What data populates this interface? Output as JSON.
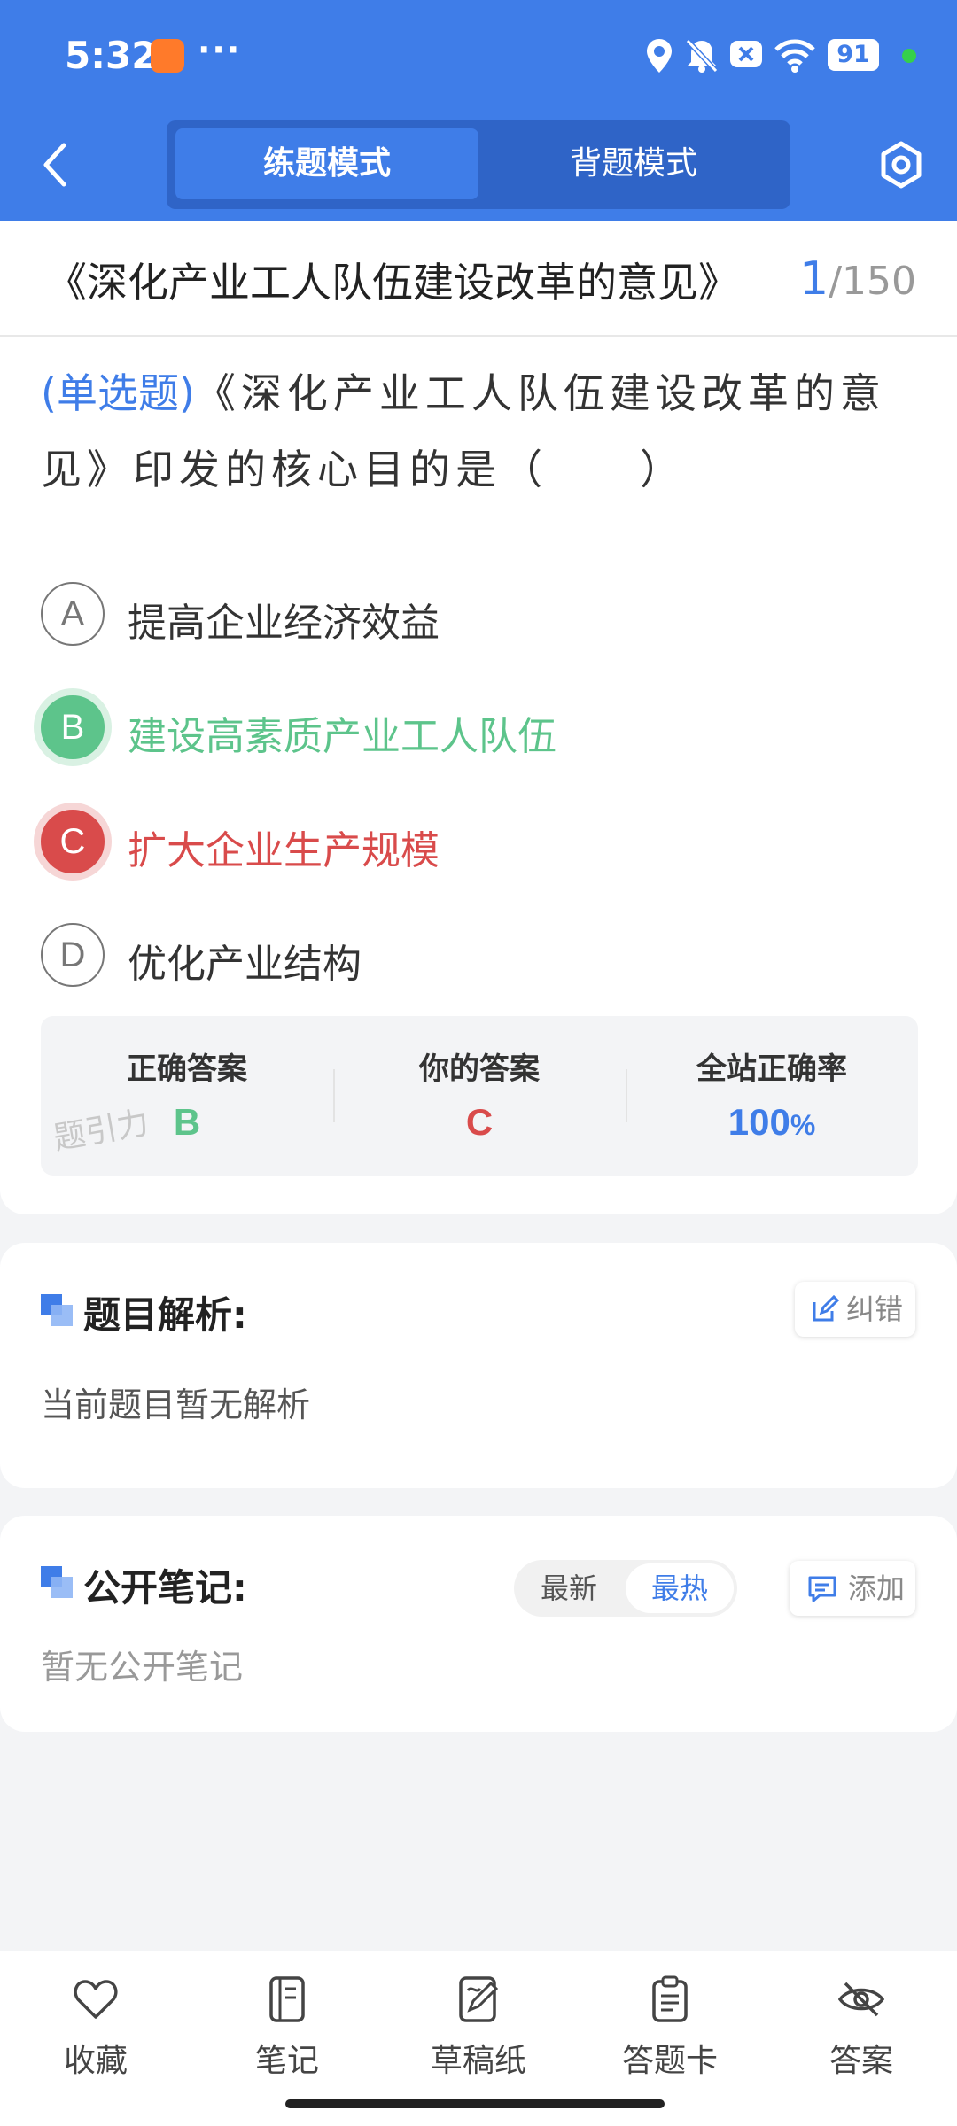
{
  "status_bar": {
    "time": "5:32",
    "more": "···",
    "battery": "91"
  },
  "header": {
    "back_icon": "chevron-left-icon",
    "mode_active": "练题模式",
    "mode_inactive": "背题模式",
    "settings_icon": "settings-hexagon-icon"
  },
  "doc": {
    "title": "《深化产业工人队伍建设改革的意见》",
    "current": "1",
    "total": "/150"
  },
  "question": {
    "type": "(单选题)",
    "text": "《深化产业工人队伍建设改革的意见》印发的核心目的是（　　）",
    "options": [
      {
        "letter": "A",
        "text": "提高企业经济效益",
        "state": "normal"
      },
      {
        "letter": "B",
        "text": "建设高素质产业工人队伍",
        "state": "correct"
      },
      {
        "letter": "C",
        "text": "扩大企业生产规模",
        "state": "wrong"
      },
      {
        "letter": "D",
        "text": "优化产业结构",
        "state": "normal"
      }
    ]
  },
  "result": {
    "correct_label": "正确答案",
    "correct_value": "B",
    "yours_label": "你的答案",
    "yours_value": "C",
    "rate_label": "全站正确率",
    "rate_value": "100",
    "rate_unit": "%",
    "watermark": "题引力"
  },
  "analysis": {
    "title": "题目解析:",
    "correct_btn": "纠错",
    "body": "当前题目暂无解析"
  },
  "notes": {
    "title": "公开笔记:",
    "sort_latest": "最新",
    "sort_hot": "最热",
    "add_btn": "添加",
    "empty": "暂无公开笔记"
  },
  "bottom_tabs": [
    {
      "label": "收藏",
      "icon": "heart-icon"
    },
    {
      "label": "笔记",
      "icon": "notebook-icon"
    },
    {
      "label": "草稿纸",
      "icon": "draft-pen-icon"
    },
    {
      "label": "答题卡",
      "icon": "answer-card-icon"
    },
    {
      "label": "答案",
      "icon": "eye-off-icon"
    }
  ],
  "colors": {
    "primary": "#3f7de8",
    "correct": "#5dc48b",
    "wrong": "#d94b4b"
  }
}
